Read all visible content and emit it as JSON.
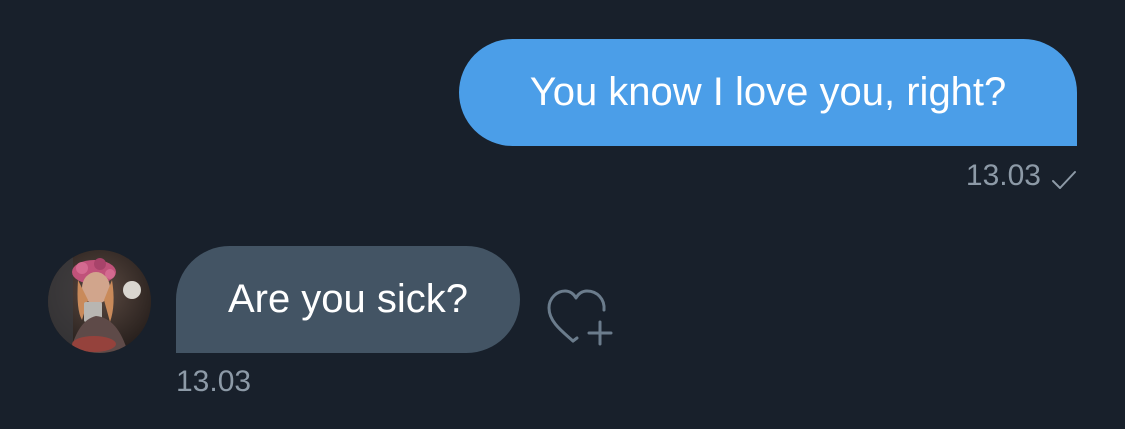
{
  "messages": {
    "outgoing": {
      "text": "You know I love you, right?",
      "time": "13.03",
      "status_icon": "check-icon"
    },
    "incoming": {
      "text": "Are you sick?",
      "time": "13.03",
      "react_icon": "heart-add-icon"
    }
  },
  "colors": {
    "background": "#18202b",
    "outgoing_bubble": "#4b9ee8",
    "incoming_bubble": "#435464",
    "meta_text": "#8d9aa7"
  }
}
